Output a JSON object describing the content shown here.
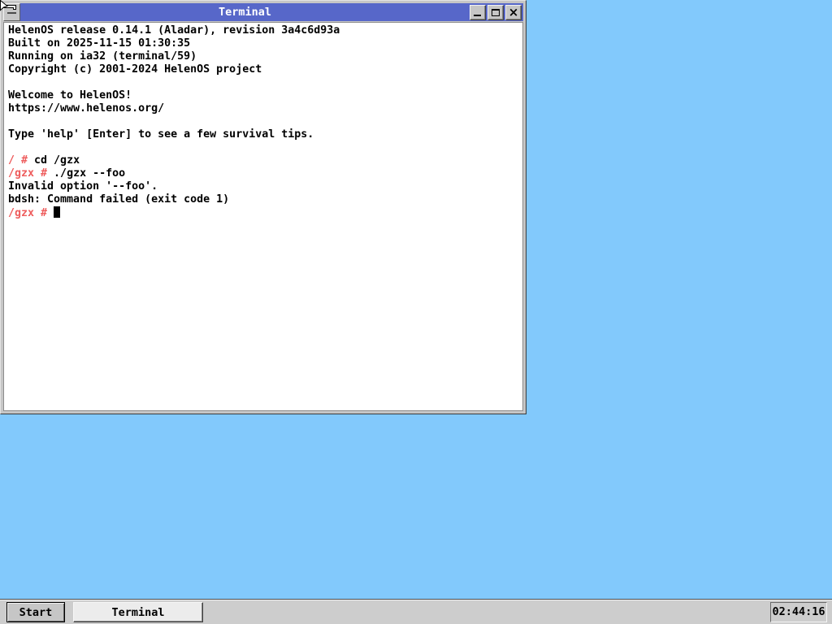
{
  "desktop": {
    "background": "#82c9fc"
  },
  "window": {
    "title": "Terminal",
    "titlebar_color": "#5767c9",
    "controls": {
      "sysmenu": "system-menu",
      "minimize": "minimize",
      "maximize": "maximize",
      "close": "close"
    }
  },
  "terminal": {
    "background": "#ffffff",
    "text_color": "#000000",
    "prompt_color": "#ee5c5c",
    "lines": [
      {
        "segments": [
          {
            "text": "HelenOS release 0.14.1 (Aladar), revision 3a4c6d93a"
          }
        ]
      },
      {
        "segments": [
          {
            "text": "Built on 2025-11-15 01:30:35"
          }
        ]
      },
      {
        "segments": [
          {
            "text": "Running on ia32 (terminal/59)"
          }
        ]
      },
      {
        "segments": [
          {
            "text": "Copyright (c) 2001-2024 HelenOS project"
          }
        ]
      },
      {
        "segments": []
      },
      {
        "segments": [
          {
            "text": "Welcome to HelenOS!"
          }
        ]
      },
      {
        "segments": [
          {
            "text": "https://www.helenos.org/"
          }
        ]
      },
      {
        "segments": []
      },
      {
        "segments": [
          {
            "text": "Type 'help' [Enter] to see a few survival tips."
          }
        ]
      },
      {
        "segments": []
      },
      {
        "segments": [
          {
            "text": "/ #",
            "color": "prompt"
          },
          {
            "text": " cd /gzx"
          }
        ]
      },
      {
        "segments": [
          {
            "text": "/gzx #",
            "color": "prompt"
          },
          {
            "text": " ./gzx --foo"
          }
        ]
      },
      {
        "segments": [
          {
            "text": "Invalid option '--foo'."
          }
        ]
      },
      {
        "segments": [
          {
            "text": "bdsh: Command failed (exit code 1)"
          }
        ]
      },
      {
        "segments": [
          {
            "text": "/gzx #",
            "color": "prompt"
          },
          {
            "text": " "
          }
        ],
        "cursor": true
      }
    ]
  },
  "taskbar": {
    "start_label": "Start",
    "tasks": [
      {
        "label": "Terminal",
        "active": true
      }
    ],
    "clock": "02:44:16"
  }
}
